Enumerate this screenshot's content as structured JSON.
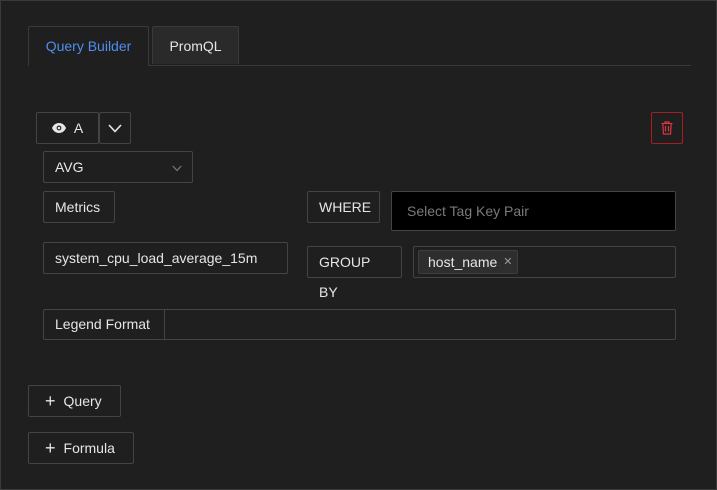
{
  "tabs": [
    {
      "label": "Query Builder",
      "active": true
    },
    {
      "label": "PromQL",
      "active": false
    }
  ],
  "query": {
    "name": "A",
    "aggregation": "AVG",
    "metrics_label": "Metrics",
    "metric_value": "system_cpu_load_average_15m",
    "where_label": "WHERE",
    "where_placeholder": "Select Tag Key Pair",
    "group_by_label": "GROUP BY",
    "group_by_tags": [
      "host_name"
    ],
    "legend_label": "Legend Format",
    "legend_value": ""
  },
  "actions": {
    "add_query": "Query",
    "add_formula": "Formula"
  },
  "colors": {
    "accent": "#4f8ef0",
    "danger": "#a61d24",
    "background": "#1f1f1f"
  },
  "icons": {
    "visibility": "eye-icon",
    "collapse": "chevron-down-icon",
    "delete": "trash-icon",
    "select": "chevron-down-icon",
    "add": "plus-icon",
    "remove_tag": "close-icon"
  }
}
